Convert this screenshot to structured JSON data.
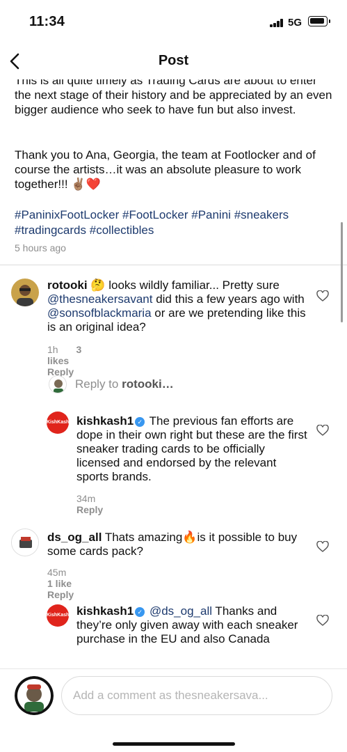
{
  "status": {
    "time": "11:34",
    "network": "5G"
  },
  "header": {
    "title": "Post"
  },
  "post": {
    "caption_partial": "This is all quite timely as Trading Cards are about to enter the next stage of their history and be appreciated by an even bigger audience who seek to have fun but also invest.",
    "caption_thanks": "Thank you to Ana, Georgia, the team at Footlocker and of course the artists…it was an absolute pleasure to work together!!! ✌🏽❤️",
    "hashtags": [
      "#PaninixFootLocker",
      "#FootLocker",
      "#Panini",
      "#sneakers",
      "#tradingcards",
      "#collectibles"
    ],
    "time_ago": "5 hours ago"
  },
  "comments": [
    {
      "user": "rotooki",
      "text_1": " 🤔 looks wildly familiar... Pretty sure ",
      "mention_1": "@thesneakersavant",
      "text_2": " did this a few years ago with ",
      "mention_2": "@sonsofblackmaria",
      "text_3": " or are we pretending like this is an original idea?",
      "time": "1h",
      "likes": "3 likes",
      "reply": "Reply"
    },
    {
      "user": "kishkash1",
      "text": "The previous fan efforts are dope in their own right but these are the first sneaker trading cards to be officially licensed and endorsed by the relevant sports brands.",
      "time": "34m",
      "reply": "Reply",
      "avatar_label": "KishKash"
    },
    {
      "user": "ds_og_all",
      "text": " Thats amazing🔥is it possible to buy some cards pack?",
      "time": "45m",
      "likes": "1 like",
      "reply": "Reply"
    },
    {
      "user": "kishkash1",
      "mention": "@ds_og_all",
      "text": " Thanks and they’re only given away with each sneaker purchase in the EU and also Canada",
      "avatar_label": "KishKash"
    }
  ],
  "reply_field": {
    "prefix": "Reply to ",
    "user": "rotooki…"
  },
  "composer": {
    "placeholder": "Add a comment as thesneakersava..."
  },
  "colors": {
    "link": "#1d3a6e",
    "muted": "#8e8e8e",
    "verified": "#3897f0"
  },
  "icons": [
    "back-arrow-icon",
    "heart-outline-icon",
    "verified-badge-icon"
  ]
}
